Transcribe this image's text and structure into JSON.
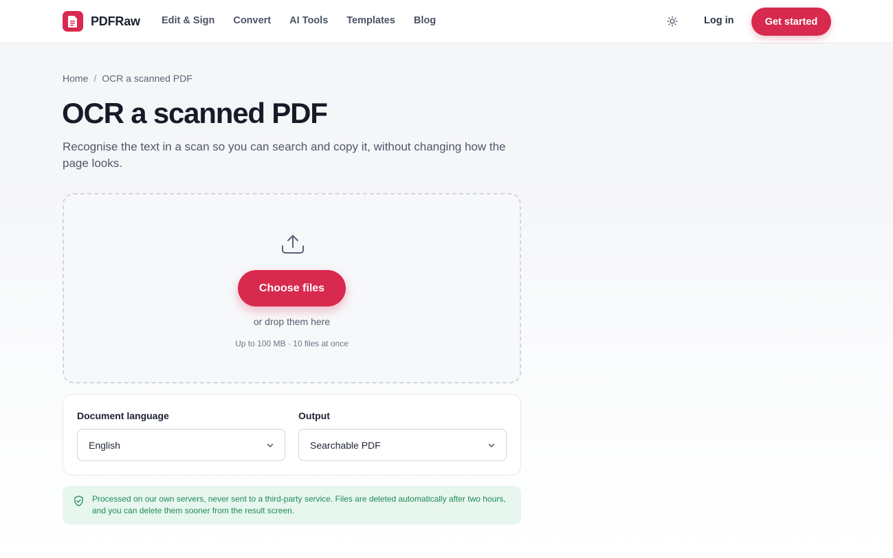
{
  "brand": {
    "name": "PDFRaw",
    "logo_icon": "document-icon",
    "accent": "#d8294e"
  },
  "nav": {
    "items": [
      "Edit & Sign",
      "Convert",
      "AI Tools",
      "Templates",
      "Blog"
    ],
    "theme_icon": "sun-icon",
    "login_label": "Log in",
    "cta_label": "Get started"
  },
  "breadcrumb": {
    "home": "Home",
    "separator": "/",
    "current": "OCR a scanned PDF"
  },
  "page": {
    "title": "OCR a scanned PDF",
    "subtitle": "Recognise the text in a scan so you can search and copy it, without changing how the page looks."
  },
  "dropzone": {
    "icon": "upload-icon",
    "button_label": "Choose files",
    "hint": "or drop them here",
    "limits": "Up to 100 MB · 10 files at once"
  },
  "options": {
    "language": {
      "label": "Document language",
      "value": "English"
    },
    "output": {
      "label": "Output",
      "value": "Searchable PDF"
    }
  },
  "notice": {
    "icon": "shield-check-icon",
    "text": "Processed on our own servers, never sent to a third-party service. Files are deleted automatically after two hours, and you can delete them sooner from the result screen.",
    "color": "#1f8a55",
    "background": "#e7f6ee"
  }
}
